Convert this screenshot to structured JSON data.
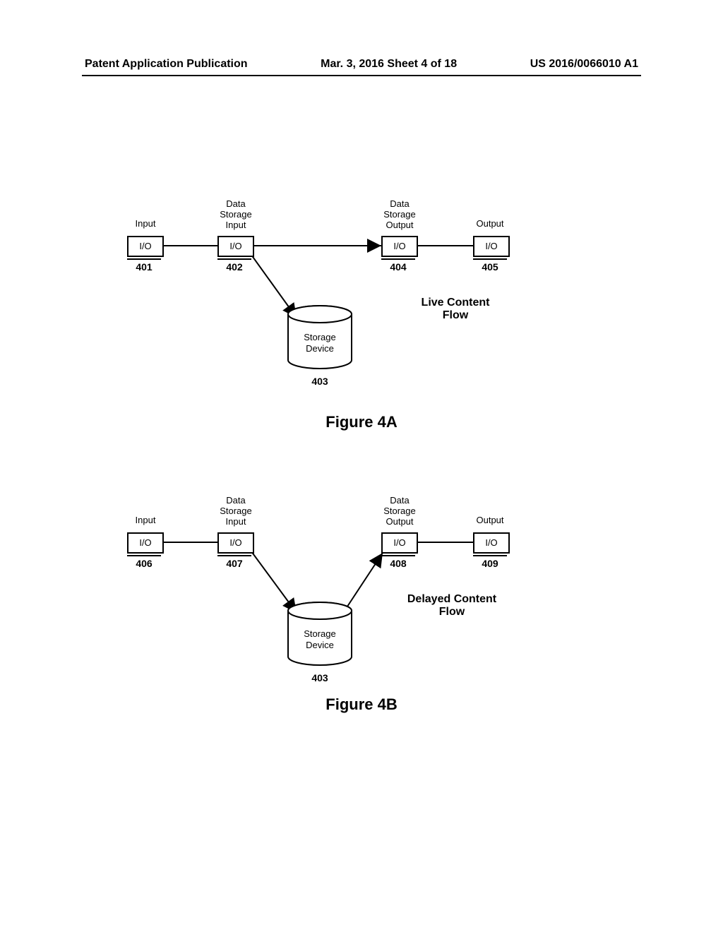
{
  "header": {
    "left": "Patent Application Publication",
    "center": "Mar. 3, 2016  Sheet 4 of 18",
    "right": "US 2016/0066010 A1"
  },
  "figA": {
    "caption": "Figure 4A",
    "flow_title_line1": "Live Content",
    "flow_title_line2": "Flow",
    "nodes": {
      "input": {
        "top": "Input",
        "box": "I/O",
        "ref": "401"
      },
      "dsi": {
        "top_l1": "Data",
        "top_l2": "Storage",
        "top_l3": "Input",
        "box": "I/O",
        "ref": "402"
      },
      "dso": {
        "top_l1": "Data",
        "top_l2": "Storage",
        "top_l3": "Output",
        "box": "I/O",
        "ref": "404"
      },
      "output": {
        "top": "Output",
        "box": "I/O",
        "ref": "405"
      }
    },
    "storage": {
      "l1": "Storage",
      "l2": "Device",
      "ref": "403"
    }
  },
  "figB": {
    "caption": "Figure 4B",
    "flow_title_line1": "Delayed Content",
    "flow_title_line2": "Flow",
    "nodes": {
      "input": {
        "top": "Input",
        "box": "I/O",
        "ref": "406"
      },
      "dsi": {
        "top_l1": "Data",
        "top_l2": "Storage",
        "top_l3": "Input",
        "box": "I/O",
        "ref": "407"
      },
      "dso": {
        "top_l1": "Data",
        "top_l2": "Storage",
        "top_l3": "Output",
        "box": "I/O",
        "ref": "408"
      },
      "output": {
        "top": "Output",
        "box": "I/O",
        "ref": "409"
      }
    },
    "storage": {
      "l1": "Storage",
      "l2": "Device",
      "ref": "403"
    }
  }
}
